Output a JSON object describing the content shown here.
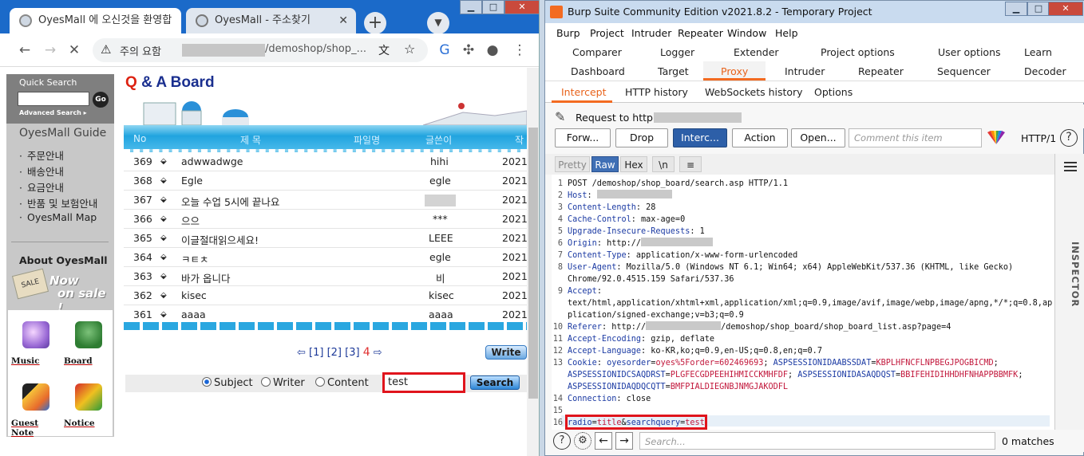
{
  "chrome": {
    "tabs": [
      {
        "title": "OyesMall 에 오신것을 환영합"
      },
      {
        "title": "OyesMall - 주소찾기"
      }
    ],
    "omnibox": {
      "label": "주의 요함",
      "path": "/demoshop/shop_..."
    }
  },
  "left": {
    "quick_search": "Quick Search",
    "go": "Go",
    "advanced": "Advanced Search ▸",
    "guide_title": "OyesMall Guide",
    "guide_items": [
      "주문안내",
      "배송안내",
      "요금안내",
      "반품 및 보험안내",
      "OyesMall Map"
    ],
    "about": "About OyesMall",
    "sale": {
      "tag": "SALE",
      "now": "Now",
      "on": "on sale !"
    },
    "icons": [
      {
        "label": "Music",
        "icon": "music-icon"
      },
      {
        "label": "Board",
        "icon": "board-icon"
      },
      {
        "label": "Guest Note",
        "icon": "guest-note-icon"
      },
      {
        "label": "Notice",
        "icon": "notice-icon"
      }
    ]
  },
  "board": {
    "title_q": "Q",
    "title_rest": "& A Board",
    "headers": [
      "No",
      "제 목",
      "파일명",
      "글쓴이",
      "작"
    ],
    "rows": [
      {
        "no": "369",
        "subject": "adwwadwge",
        "writer": "hihi",
        "date": "2021"
      },
      {
        "no": "368",
        "subject": "Egle",
        "writer": "egle",
        "date": "2021"
      },
      {
        "no": "367",
        "subject": "오늘 수업 5시에 끝나요",
        "writer": "",
        "date": "2021"
      },
      {
        "no": "366",
        "subject": "으으",
        "writer": "***",
        "date": "2021"
      },
      {
        "no": "365",
        "subject": "이글절대읽으세요!",
        "writer": "LEEE",
        "date": "2021"
      },
      {
        "no": "364",
        "subject": "ㅋㅌㅊ",
        "writer": "egle",
        "date": "2021"
      },
      {
        "no": "363",
        "subject": "바가 옵니다",
        "writer": "비",
        "date": "2021"
      },
      {
        "no": "362",
        "subject": "kisec",
        "writer": "kisec",
        "date": "2021"
      },
      {
        "no": "361",
        "subject": "aaaa",
        "writer": "aaaa",
        "date": "2021"
      }
    ],
    "pager": {
      "pages": "[1] [2] [3]",
      "current": "4"
    },
    "write": "Write",
    "search": {
      "options": [
        "Subject",
        "Writer",
        "Content"
      ],
      "selected": "Subject",
      "query": "test",
      "button": "Search"
    }
  },
  "burp": {
    "title": "Burp Suite Community Edition v2021.8.2 - Temporary Project",
    "menu": [
      "Burp",
      "Project",
      "Intruder",
      "Repeater",
      "Window",
      "Help"
    ],
    "tabs_row1": [
      "Comparer",
      "Logger",
      "Extender",
      "Project options",
      "User options",
      "Learn"
    ],
    "tabs_row2": [
      "Dashboard",
      "Target",
      "Proxy",
      "Intruder",
      "Repeater",
      "Sequencer",
      "Decoder"
    ],
    "proxy_tabs": [
      "Intercept",
      "HTTP history",
      "WebSockets history",
      "Options"
    ],
    "request_to": "Request to http://",
    "buttons": [
      "Forw...",
      "Drop",
      "Interc...",
      "Action",
      "Open..."
    ],
    "comment_placeholder": "Comment this item",
    "http_version": "HTTP/1",
    "view_buttons": [
      "Pretty",
      "Raw",
      "Hex",
      "\\n"
    ],
    "inspector": "INSPECTOR",
    "search_placeholder": "Search...",
    "matches": "0 matches",
    "request_lines": [
      "POST /demoshop/shop_board/search.asp HTTP/1.1",
      "Host: ",
      "Content-Length: 28",
      "Cache-Control: max-age=0",
      "Upgrade-Insecure-Requests: 1",
      "Origin: http://",
      "Content-Type: application/x-www-form-urlencoded",
      "User-Agent: Mozilla/5.0 (Windows NT 6.1; Win64; x64) AppleWebKit/537.36 (KHTML, like Gecko)",
      "Chrome/92.0.4515.159 Safari/537.36",
      "Accept:",
      "text/html,application/xhtml+xml,application/xml;q=0.9,image/avif,image/webp,image/apng,*/*;q=0.8,ap",
      "plication/signed-exchange;v=b3;q=0.9",
      "Referer: http://",
      "/demoshop/shop_board/shop_board_list.asp?page=4",
      "Accept-Encoding: gzip, deflate",
      "Accept-Language: ko-KR,ko;q=0.9,en-US;q=0.8,en;q=0.7",
      "Cookie: oyesorder=oyes%5Forder=602469693; ASPSESSIONIDAABSSDAT=KBPLHFNCFLNPBEGJPOGBICMD;",
      "ASPSESSIONIDCSAQDRST=PLGFECGDPEEHIHMICCKMHFDF; ASPSESSIONIDASAQDQST=BBIFEHIDIHHDHFNHAPPBBMFK;",
      "ASPSESSIONIDAQDQCQTT=BMFPIALDIEGNBJNMGJAKODFL",
      "Connection: close",
      "",
      "radio=title&searchquery=test"
    ]
  }
}
